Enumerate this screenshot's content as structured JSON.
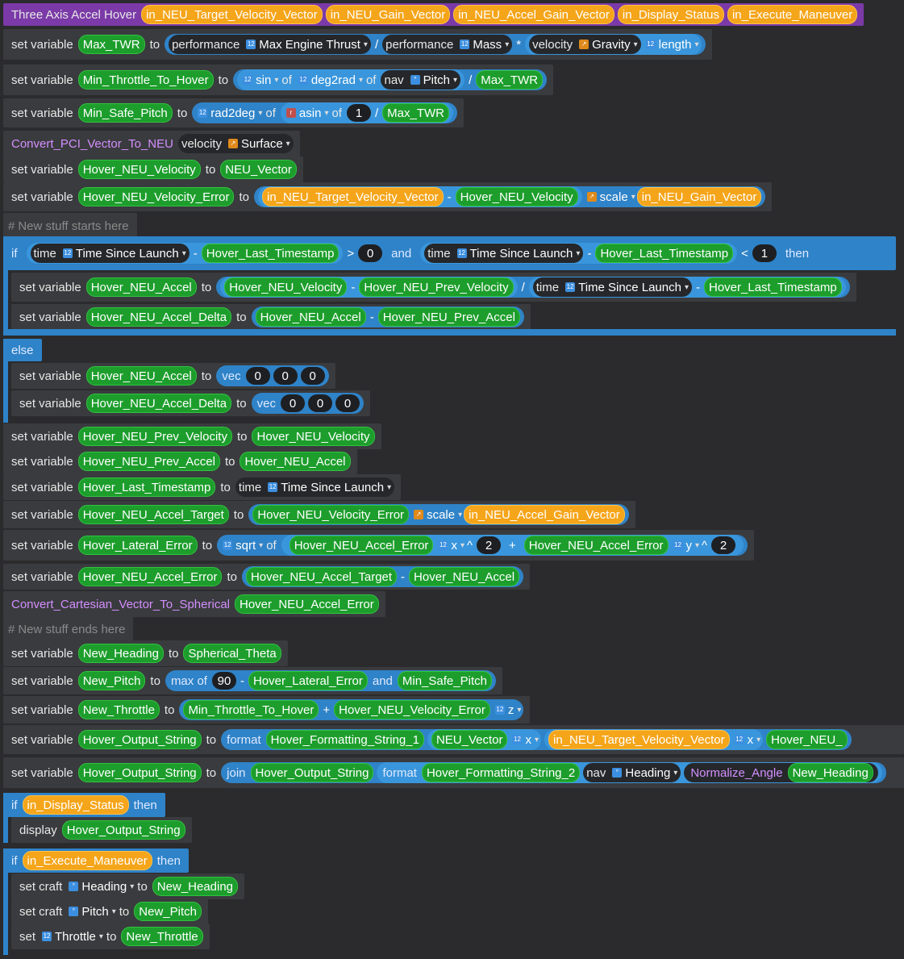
{
  "title": {
    "name": "Three Axis Accel Hover",
    "params": [
      "in_NEU_Target_Velocity_Vector",
      "in_NEU_Gain_Vector",
      "in_NEU_Accel_Gain_Vector",
      "in_Display_Status",
      "in_Execute_Maneuver"
    ]
  },
  "kw": {
    "set_variable": "set variable",
    "to": "to",
    "of": "of",
    "and": "and",
    "if": "if",
    "then": "then",
    "else": "else",
    "display": "display",
    "set_craft": "set craft",
    "set": "set",
    "format": "format",
    "join": "join",
    "max_of": "max of",
    "vec": "vec"
  },
  "labels": {
    "performance": "performance",
    "velocity": "velocity",
    "nav": "nav",
    "time": "time"
  },
  "vars": {
    "Max_TWR": "Max_TWR",
    "Min_Throttle_To_Hover": "Min_Throttle_To_Hover",
    "Min_Safe_Pitch": "Min_Safe_Pitch",
    "Hover_NEU_Velocity": "Hover_NEU_Velocity",
    "NEU_Vector": "NEU_Vector",
    "Hover_NEU_Velocity_Error": "Hover_NEU_Velocity_Error",
    "Hover_Last_Timestamp": "Hover_Last_Timestamp",
    "Hover_NEU_Accel": "Hover_NEU_Accel",
    "Hover_NEU_Prev_Velocity": "Hover_NEU_Prev_Velocity",
    "Hover_NEU_Accel_Delta": "Hover_NEU_Accel_Delta",
    "Hover_NEU_Prev_Accel": "Hover_NEU_Prev_Accel",
    "Hover_NEU_Accel_Target": "Hover_NEU_Accel_Target",
    "Hover_Lateral_Error": "Hover_Lateral_Error",
    "Hover_NEU_Accel_Error": "Hover_NEU_Accel_Error",
    "New_Heading": "New_Heading",
    "Spherical_Theta": "Spherical_Theta",
    "New_Pitch": "New_Pitch",
    "New_Throttle": "New_Throttle",
    "Hover_Output_String": "Hover_Output_String",
    "Hover_Formatting_String_1": "Hover_Formatting_String_1",
    "Hover_Formatting_String_2": "Hover_Formatting_String_2",
    "Hover_NEU_trunc": "Hover_NEU_"
  },
  "fields": {
    "max_engine_thrust": "Max Engine Thrust",
    "mass": "Mass",
    "gravity": "Gravity",
    "length": "length",
    "sin": "sin",
    "deg2rad": "deg2rad",
    "pitch": "Pitch",
    "rad2deg": "rad2deg",
    "asin": "asin",
    "surface": "Surface",
    "scale": "scale",
    "time_since_launch": "Time Since Launch",
    "sqrt": "sqrt",
    "x": "x",
    "y": "y",
    "z": "z",
    "heading": "Heading",
    "throttle": "Throttle"
  },
  "procs": {
    "convert_pci": "Convert_PCI_Vector_To_NEU",
    "convert_cart": "Convert_Cartesian_Vector_To_Spherical",
    "normalize": "Normalize_Angle"
  },
  "comments": {
    "start": "New stuff starts here",
    "end": "New stuff ends here"
  },
  "nums": {
    "zero": "0",
    "one": "1",
    "two": "2",
    "ninety": "90"
  }
}
